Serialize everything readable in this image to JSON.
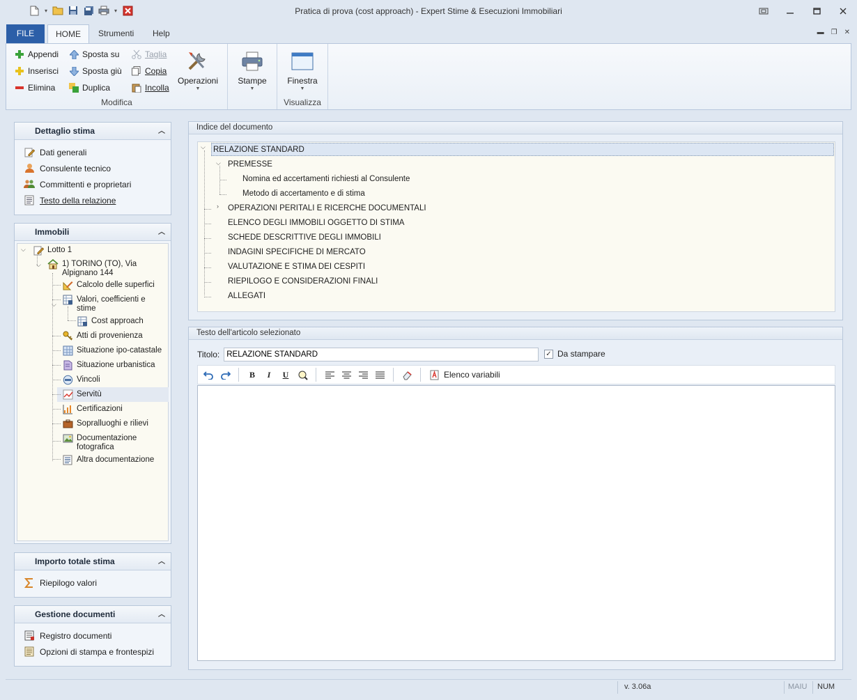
{
  "window": {
    "title": "Pratica di prova (cost approach) - Expert Stime & Esecuzioni Immobiliari"
  },
  "ribbon": {
    "tabs": [
      "FILE",
      "HOME",
      "Strumenti",
      "Help"
    ],
    "active_tab": "HOME",
    "groups": {
      "modifica": {
        "label": "Modifica",
        "col1": [
          "Appendi",
          "Inserisci",
          "Elimina"
        ],
        "col2": [
          "Sposta su",
          "Sposta giù",
          "Duplica"
        ],
        "col3": [
          "Taglia",
          "Copia",
          "Incolla"
        ],
        "operazioni": "Operazioni"
      },
      "stampe": {
        "label": "Stampe"
      },
      "visualizza": {
        "label": "Visualizza",
        "finestra": "Finestra"
      }
    }
  },
  "left": {
    "dettaglio": {
      "title": "Dettaglio stima",
      "items": [
        "Dati generali",
        "Consulente tecnico",
        "Committenti e proprietari",
        "Testo della relazione"
      ]
    },
    "immobili": {
      "title": "Immobili",
      "tree": {
        "lotto": "Lotto 1",
        "immobile": "1) TORINO (TO), Via Alpignano 144",
        "children": [
          "Calcolo delle superfici",
          "Valori, coefficienti e stime",
          "Cost approach",
          "Atti di provenienza",
          "Situazione ipo-catastale",
          "Situazione urbanistica",
          "Vincoli",
          "Servitù",
          "Certificazioni",
          "Sopralluoghi e rilievi",
          "Documentazione fotografica",
          "Altra documentazione"
        ],
        "selected": "Servitù"
      }
    },
    "importo": {
      "title": "Importo totale stima",
      "items": [
        "Riepilogo valori"
      ]
    },
    "gestione": {
      "title": "Gestione documenti",
      "items": [
        "Registro documenti",
        "Opzioni di stampa e frontespizi"
      ]
    }
  },
  "indice": {
    "title": "Indice del documento",
    "rows": [
      "RELAZIONE STANDARD",
      "PREMESSE",
      "Nomina ed accertamenti richiesti al Consulente",
      "Metodo di accertamento e di stima",
      "OPERAZIONI PERITALI E RICERCHE DOCUMENTALI",
      "ELENCO DEGLI IMMOBILI OGGETTO DI STIMA",
      "SCHEDE DESCRITTIVE DEGLI IMMOBILI",
      "INDAGINI SPECIFICHE DI MERCATO",
      "VALUTAZIONE E STIMA DEI CESPITI",
      "RIEPILOGO E CONSIDERAZIONI FINALI",
      "ALLEGATI"
    ]
  },
  "articolo": {
    "title": "Testo dell'articolo selezionato",
    "titolo_label": "Titolo:",
    "titolo_value": "RELAZIONE STANDARD",
    "da_stampare_label": "Da stampare",
    "da_stampare_checked": true,
    "toolbar": {
      "elenco_variabili": "Elenco variabili",
      "bold": "B",
      "italic": "I",
      "underline": "U"
    },
    "body": ""
  },
  "status": {
    "version": "v. 3.06a",
    "maiu": "MAIU",
    "num": "NUM"
  },
  "colors": {
    "file_tab": "#2c5fa8",
    "tree_background": "#fbfaf2",
    "window_background": "#dfe7f1"
  }
}
